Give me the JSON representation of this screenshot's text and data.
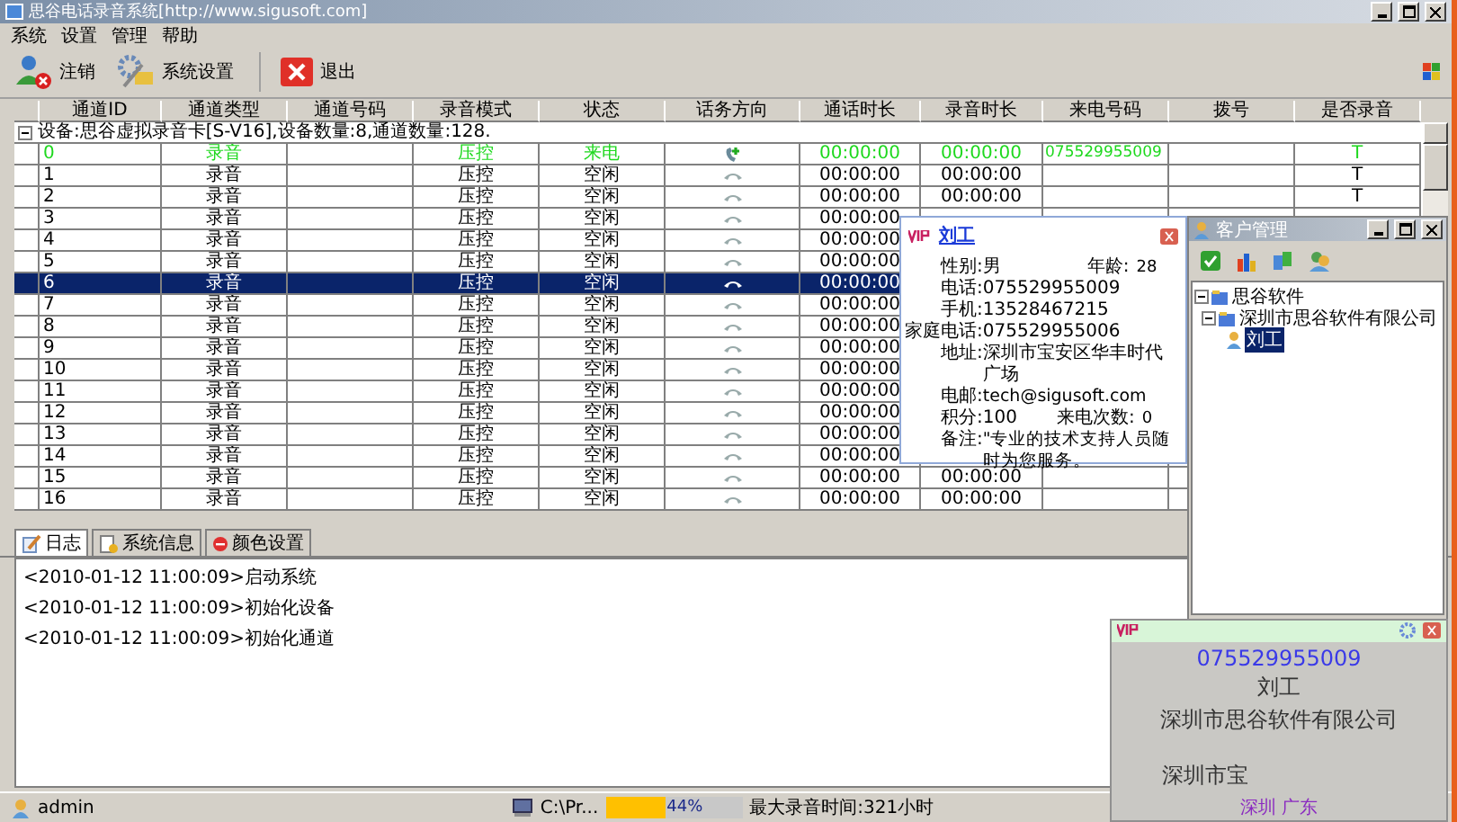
{
  "window": {
    "title": "思谷电话录音系统[http://www.sigusoft.com]"
  },
  "menu": [
    "系统",
    "设置",
    "管理",
    "帮助"
  ],
  "toolbar": [
    {
      "label": "注销",
      "kind": "logout"
    },
    {
      "label": "系统设置",
      "kind": "settings"
    },
    {
      "label": "退出",
      "kind": "exit"
    }
  ],
  "table": {
    "columns": [
      "通道ID",
      "通道类型",
      "通道号码",
      "录音模式",
      "状态",
      "话务方向",
      "通话时长",
      "录音时长",
      "来电号码",
      "拨号",
      "是否录音"
    ],
    "group": "设备:思谷虚拟录音卡[S-V16],设备数量:8,通道数量:128.",
    "rows": [
      {
        "id": "0",
        "type": "录音",
        "mode": "压控",
        "status": "来电",
        "incoming": true,
        "talk": "00:00:00",
        "rec": "00:00:00",
        "caller": "075529955009",
        "record": "T",
        "active": true,
        "selected": false
      },
      {
        "id": "1",
        "type": "录音",
        "mode": "压控",
        "status": "空闲",
        "incoming": false,
        "talk": "00:00:00",
        "rec": "00:00:00",
        "record": "T",
        "active": false,
        "selected": false
      },
      {
        "id": "2",
        "type": "录音",
        "mode": "压控",
        "status": "空闲",
        "incoming": false,
        "talk": "00:00:00",
        "rec": "00:00:00",
        "record": "T",
        "active": false,
        "selected": false
      },
      {
        "id": "3",
        "type": "录音",
        "mode": "压控",
        "status": "空闲",
        "incoming": false,
        "talk": "00:00:00",
        "active": false,
        "selected": false
      },
      {
        "id": "4",
        "type": "录音",
        "mode": "压控",
        "status": "空闲",
        "incoming": false,
        "talk": "00:00:00",
        "active": false,
        "selected": false
      },
      {
        "id": "5",
        "type": "录音",
        "mode": "压控",
        "status": "空闲",
        "incoming": false,
        "talk": "00:00:00",
        "active": false,
        "selected": false
      },
      {
        "id": "6",
        "type": "录音",
        "mode": "压控",
        "status": "空闲",
        "incoming": false,
        "talk": "00:00:00",
        "active": false,
        "selected": true
      },
      {
        "id": "7",
        "type": "录音",
        "mode": "压控",
        "status": "空闲",
        "incoming": false,
        "talk": "00:00:00",
        "active": false,
        "selected": false
      },
      {
        "id": "8",
        "type": "录音",
        "mode": "压控",
        "status": "空闲",
        "incoming": false,
        "talk": "00:00:00",
        "active": false,
        "selected": false
      },
      {
        "id": "9",
        "type": "录音",
        "mode": "压控",
        "status": "空闲",
        "incoming": false,
        "talk": "00:00:00",
        "active": false,
        "selected": false
      },
      {
        "id": "10",
        "type": "录音",
        "mode": "压控",
        "status": "空闲",
        "incoming": false,
        "talk": "00:00:00",
        "active": false,
        "selected": false
      },
      {
        "id": "11",
        "type": "录音",
        "mode": "压控",
        "status": "空闲",
        "incoming": false,
        "talk": "00:00:00",
        "active": false,
        "selected": false
      },
      {
        "id": "12",
        "type": "录音",
        "mode": "压控",
        "status": "空闲",
        "incoming": false,
        "talk": "00:00:00",
        "active": false,
        "selected": false
      },
      {
        "id": "13",
        "type": "录音",
        "mode": "压控",
        "status": "空闲",
        "incoming": false,
        "talk": "00:00:00",
        "active": false,
        "selected": false
      },
      {
        "id": "14",
        "type": "录音",
        "mode": "压控",
        "status": "空闲",
        "incoming": false,
        "talk": "00:00:00",
        "active": false,
        "selected": false
      },
      {
        "id": "15",
        "type": "录音",
        "mode": "压控",
        "status": "空闲",
        "incoming": false,
        "talk": "00:00:00",
        "rec": "00:00:00",
        "active": false,
        "selected": false
      },
      {
        "id": "16",
        "type": "录音",
        "mode": "压控",
        "status": "空闲",
        "incoming": false,
        "talk": "00:00:00",
        "rec": "00:00:00",
        "active": false,
        "selected": false
      }
    ]
  },
  "tabs": [
    {
      "label": "日志",
      "kind": "log",
      "selected": true
    },
    {
      "label": "系统信息",
      "kind": "info",
      "selected": false
    },
    {
      "label": "颜色设置",
      "kind": "color",
      "selected": false
    }
  ],
  "log": [
    "<2010-01-12 11:00:09>启动系统",
    "<2010-01-12 11:00:09>初始化设备",
    "<2010-01-12 11:00:09>初始化通道"
  ],
  "status_bar": {
    "user": "admin",
    "path": "C:\\Pr...",
    "disk": {
      "level": 0.44,
      "reading": "44%"
    },
    "max_time": "最大录音时间:321小时"
  },
  "contact_popup": {
    "name": "刘工",
    "fields": [
      {
        "label": "性别:",
        "value": "男",
        "label2": "年龄:",
        "value2": "28"
      },
      {
        "label": "电话:",
        "value": "075529955009"
      },
      {
        "label": "手机:",
        "value": "13528467215"
      },
      {
        "label": "家庭电话:",
        "value": "075529955006"
      },
      {
        "label": "地址:",
        "value": "深圳市宝安区华丰时代广场"
      },
      {
        "label": "电邮:",
        "value": "tech@sigusoft.com"
      },
      {
        "label": "积分:",
        "value": "100",
        "label2": "来电次数:",
        "value2": "0"
      },
      {
        "label": "备注:",
        "value": "\"专业的技术支持人员随时为您服务。"
      }
    ]
  },
  "customer_window": {
    "title": "客户管理",
    "tree": [
      {
        "label": "思谷软件",
        "expanded": true,
        "selected": false,
        "children": [
          {
            "label": "深圳市思谷软件有限公司",
            "expanded": true,
            "selected": false,
            "children": [
              {
                "label": "刘工",
                "selected": true
              }
            ]
          }
        ]
      }
    ]
  },
  "caller_popup": {
    "number": "075529955009",
    "name": "刘工",
    "company": "深圳市思谷软件有限公司",
    "address": "深圳市宝",
    "region": "深圳 广东"
  }
}
